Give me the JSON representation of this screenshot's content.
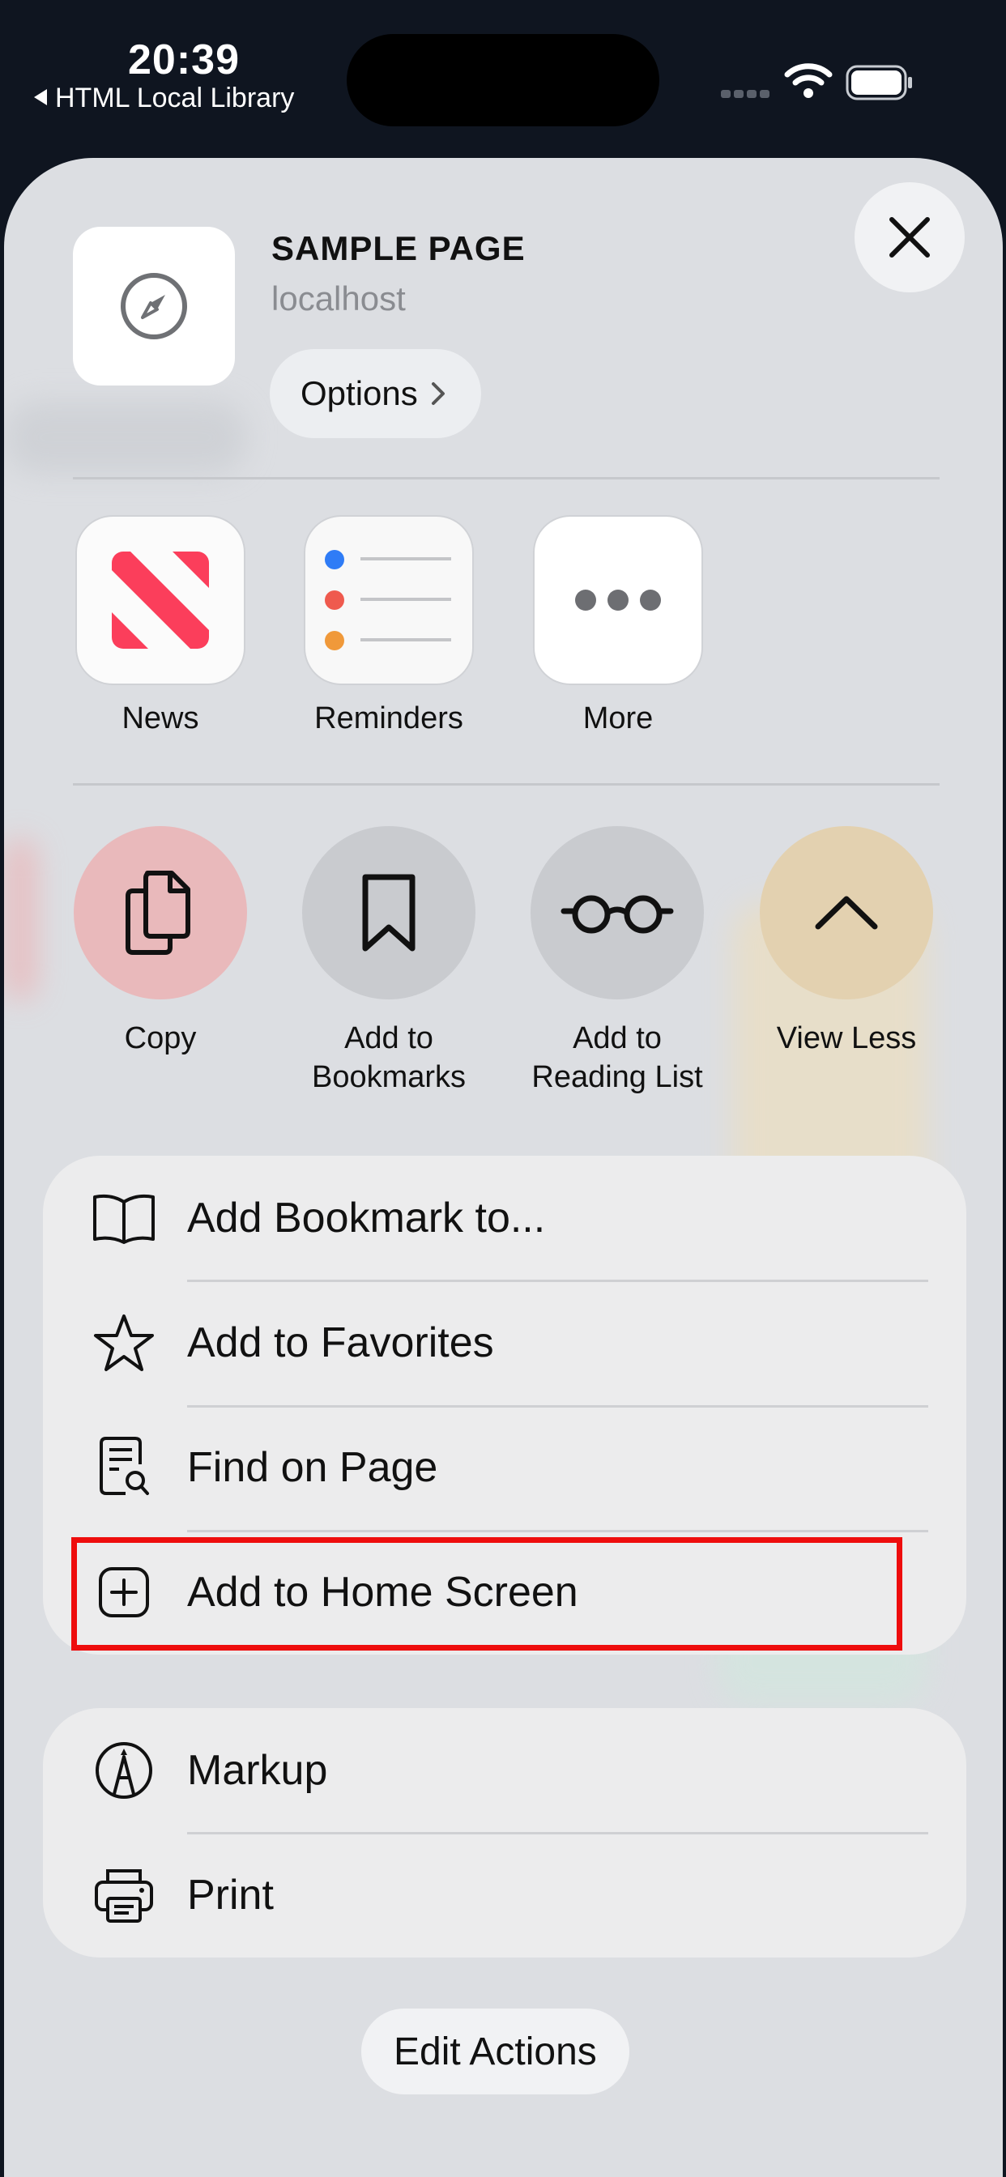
{
  "status_bar": {
    "time": "20:39",
    "back_app": "HTML Local Library"
  },
  "header": {
    "title": "SAMPLE PAGE",
    "subtitle": "localhost",
    "options_label": "Options"
  },
  "apps": [
    {
      "label": "News",
      "icon": "news-icon"
    },
    {
      "label": "Reminders",
      "icon": "reminders-icon"
    },
    {
      "label": "More",
      "icon": "more-icon"
    }
  ],
  "actions": [
    {
      "label": "Copy",
      "icon": "copy-icon",
      "color": "#e9b9bb"
    },
    {
      "label": "Add to\nBookmarks",
      "icon": "bookmark-icon",
      "color": "#c9cbcf"
    },
    {
      "label": "Add to\nReading List",
      "icon": "glasses-icon",
      "color": "#c9cbcf"
    },
    {
      "label": "View Less",
      "icon": "chevron-up-icon",
      "color": "#e3d1b0"
    }
  ],
  "menu_group_1": [
    {
      "label": "Add Bookmark to...",
      "icon": "book-icon"
    },
    {
      "label": "Add to Favorites",
      "icon": "star-icon"
    },
    {
      "label": "Find on Page",
      "icon": "find-on-page-icon"
    },
    {
      "label": "Add to Home Screen",
      "icon": "plus-square-icon"
    }
  ],
  "menu_group_2": [
    {
      "label": "Markup",
      "icon": "markup-icon"
    },
    {
      "label": "Print",
      "icon": "printer-icon"
    }
  ],
  "footer": {
    "edit_actions": "Edit Actions"
  },
  "colors": {
    "highlight": "#ee0d0d",
    "sheet": "#dcdee2",
    "news": "#fb3e5b"
  }
}
